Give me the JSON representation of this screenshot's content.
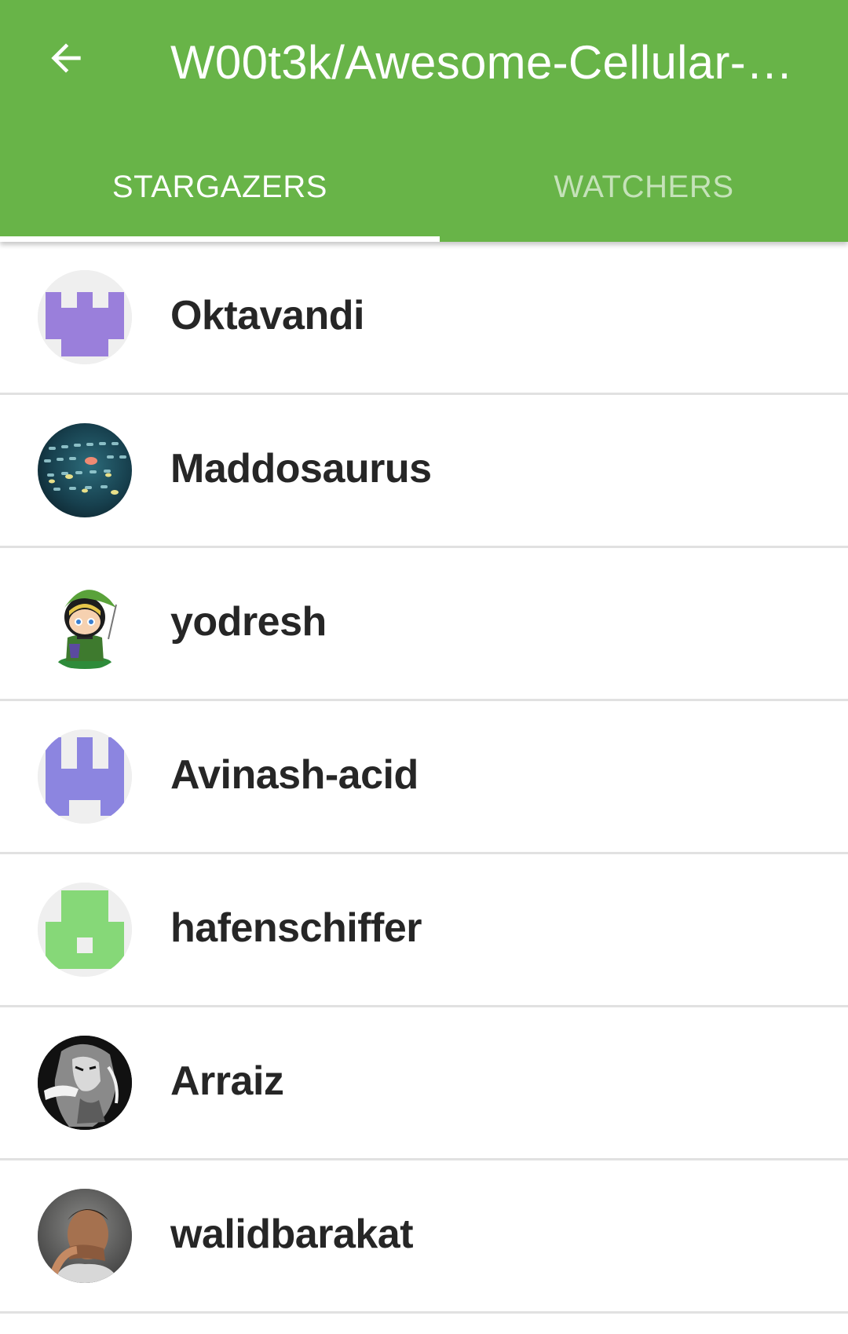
{
  "header": {
    "title": "W00t3k/Awesome-Cellular-H...",
    "back_icon": "arrow-back-icon",
    "background": "#68b448"
  },
  "tabs": [
    {
      "label": "STARGAZERS",
      "active": true
    },
    {
      "label": "WATCHERS",
      "active": false
    }
  ],
  "users": [
    {
      "name": "Oktavandi",
      "avatar": "identicon-purple-icon"
    },
    {
      "name": "Maddosaurus",
      "avatar": "keyboard-photo-avatar"
    },
    {
      "name": "yodresh",
      "avatar": "link-octocat-avatar"
    },
    {
      "name": "Avinash-acid",
      "avatar": "identicon-blue-purple-icon"
    },
    {
      "name": "hafenschiffer",
      "avatar": "identicon-green-icon"
    },
    {
      "name": "Arraiz",
      "avatar": "bw-drawing-avatar"
    },
    {
      "name": "walidbarakat",
      "avatar": "person-photo-avatar"
    }
  ]
}
